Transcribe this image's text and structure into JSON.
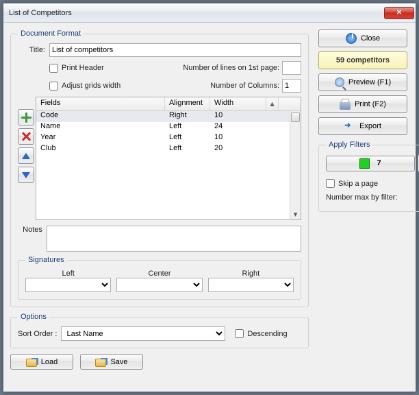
{
  "window": {
    "title": "List of Competitors"
  },
  "rightPanel": {
    "close": "Close",
    "status": "59 competitors",
    "preview": "Preview (F1)",
    "print": "Print (F2)",
    "export": "Export"
  },
  "applyFilters": {
    "legend": "Apply Filters",
    "count": "7",
    "skipPage": "Skip a page",
    "skipChecked": false,
    "maxLabel": "Number max by filter:",
    "maxValue": ""
  },
  "docFormat": {
    "legend": "Document Format",
    "titleLabel": "Title:",
    "titleValue": "List of competitors",
    "printHeader": "Print Header",
    "printHeaderChecked": false,
    "linesLabel": "Number of lines on 1st page:",
    "linesValue": "",
    "adjustWidth": "Adjust grids width",
    "adjustWidthChecked": false,
    "colsLabel": "Number of Columns:",
    "colsValue": "1",
    "headers": {
      "fields": "Fields",
      "align": "Alignment",
      "width": "Width"
    },
    "rows": [
      {
        "field": "Code",
        "align": "Right",
        "width": "10"
      },
      {
        "field": "Name",
        "align": "Left",
        "width": "24"
      },
      {
        "field": "Year",
        "align": "Left",
        "width": "10"
      },
      {
        "field": "Club",
        "align": "Left",
        "width": "20"
      }
    ],
    "notesLabel": "Notes",
    "notesValue": ""
  },
  "signatures": {
    "legend": "Signatures",
    "left": "Left",
    "center": "Center",
    "right": "Right",
    "leftValue": "",
    "centerValue": "",
    "rightValue": ""
  },
  "options": {
    "legend": "Options",
    "sortLabel": "Sort Order :",
    "sortValue": "Last Name",
    "descending": "Descending",
    "descendingChecked": false
  },
  "bottom": {
    "load": "Load",
    "save": "Save"
  }
}
